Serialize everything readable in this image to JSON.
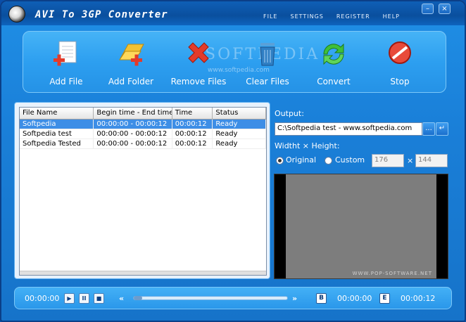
{
  "app": {
    "title": "AVI To 3GP Converter"
  },
  "menu": [
    "FILE",
    "SETTINGS",
    "REGISTER",
    "HELP"
  ],
  "window_controls": {
    "minimize": "–",
    "close": "×"
  },
  "toolbar": [
    {
      "label": "Add File",
      "icon": "add-file-icon"
    },
    {
      "label": "Add Folder",
      "icon": "add-folder-icon"
    },
    {
      "label": "Remove Files",
      "icon": "remove-files-icon"
    },
    {
      "label": "Clear Files",
      "icon": "clear-files-icon"
    },
    {
      "label": "Convert",
      "icon": "convert-icon"
    },
    {
      "label": "Stop",
      "icon": "stop-icon"
    }
  ],
  "watermark": {
    "text": "SOFTPEDIA",
    "url": "www.softpedia.com"
  },
  "file_table": {
    "columns": [
      "File Name",
      "Begin time - End time",
      "Time",
      "Status"
    ],
    "rows": [
      {
        "name": "Softpedia",
        "range": "00:00:00 - 00:00:12",
        "time": "00:00:12",
        "status": "Ready",
        "selected": true
      },
      {
        "name": "Softpedia test",
        "range": "00:00:00 - 00:00:12",
        "time": "00:00:12",
        "status": "Ready",
        "selected": false
      },
      {
        "name": "Softpedia Tested",
        "range": "00:00:00 - 00:00:12",
        "time": "00:00:12",
        "status": "Ready",
        "selected": false
      }
    ]
  },
  "output": {
    "label": "Output:",
    "path": "C:\\Softpedia test - www.softpedia.com",
    "browse_label": "...",
    "open_label": "↵"
  },
  "size": {
    "label": "Widtht × Height:",
    "original_label": "Original",
    "custom_label": "Custom",
    "selected": "original",
    "width": "176",
    "height": "144",
    "separator": "×"
  },
  "preview": {
    "mark": "WWW.POP-SOFTWARE.NET"
  },
  "player": {
    "current_time": "00:00:00",
    "play": "▶",
    "pause": "II",
    "stop": "■",
    "seek_back": "«",
    "seek_forward": "»",
    "begin_label": "B",
    "begin_time": "00:00:00",
    "end_label": "E",
    "end_time": "00:00:12",
    "progress": 0
  },
  "colors": {
    "window": "#1a7fd8",
    "toolbar": "#2d9ff0",
    "selected_row": "#3d8ee6",
    "remove_red": "#e33b2a",
    "convert_green": "#3fbf3a"
  }
}
